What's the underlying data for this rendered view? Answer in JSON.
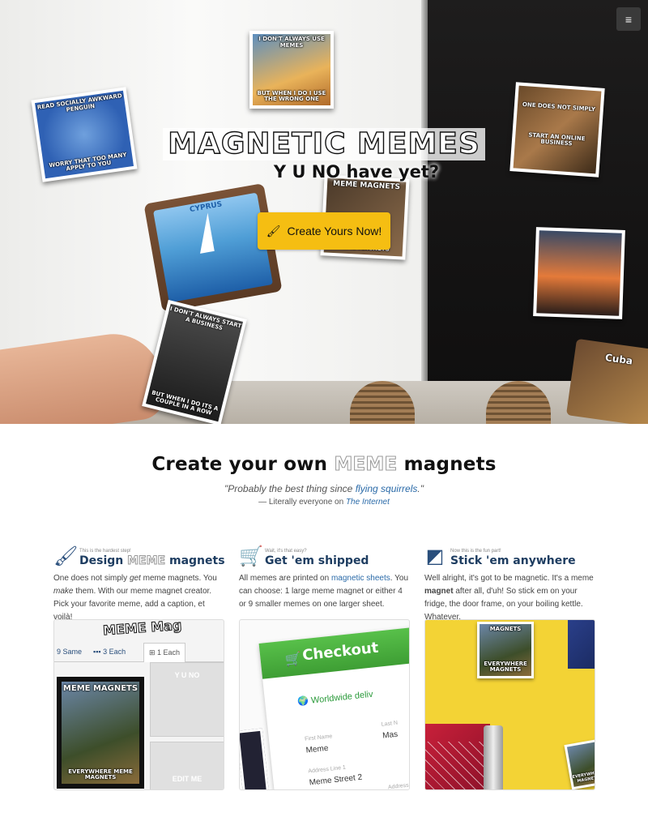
{
  "hero": {
    "logo_text": "MAGNETIC MEMES",
    "tagline": "Y U NO have yet?",
    "cta_label": "Create Yours Now!",
    "cta_icon": "paintbrush-icon",
    "menu_icon": "hamburger-icon",
    "magnets": {
      "penguin_top": "READ SOCIALLY AWKWARD PENGUIN",
      "penguin_bottom": "WORRY THAT TOO MANY APPLY TO YOU",
      "fry_top": "I DON'T ALWAYS USE MEMES",
      "fry_bottom": "BUT WHEN I DO I USE THE WRONG ONE",
      "boromir_top": "ONE DOES NOT SIMPLY",
      "boromir_bottom": "START AN ONLINE BUSINESS",
      "meme_magnets_top": "MEME MAGNETS",
      "meme_magnets_bottom": "MEME MAGNETS",
      "dosequis_top": "I DON'T ALWAYS START A BUSINESS",
      "dosequis_bottom": "BUT WHEN I DO ITS A COUPLE IN A ROW",
      "cyprus_label": "CYPRUS",
      "cuba_label": "Cuba"
    }
  },
  "intro": {
    "heading_pre": "Create your own ",
    "heading_meme": "MEME",
    "heading_post": " magnets",
    "quote_pre": "\"Probably the best thing since ",
    "quote_link": "flying squirrels",
    "quote_post": ".\"",
    "attrib_pre": "— Literally everyone on ",
    "attrib_link": "The Internet"
  },
  "features": [
    {
      "small": "This is the hardest step!",
      "title_pre": "Design ",
      "title_meme": "MEME",
      "title_post": " magnets",
      "icon": "paintbrush-icon",
      "text_a": "One does not simply ",
      "text_em": "get",
      "text_b": " meme magnets. You ",
      "text_em2": "make",
      "text_c": " them. With our meme magnet creator. Pick your favorite meme, add a caption, et voilà!"
    },
    {
      "small": "Wait, it's that easy?",
      "title": "Get 'em shipped",
      "icon": "cart-icon",
      "text_a": "All memes are printed on ",
      "text_link": "magnetic sheets",
      "text_b": ". You can choose: 1 large meme magnet or either 4 or 9 smaller memes on one larger sheet."
    },
    {
      "small": "Now this is the fun part!",
      "title": "Stick 'em anywhere",
      "icon": "sticky-note-icon",
      "text_a": "Well alright, it's got to be magnetic. It's a meme ",
      "text_strong": "magnet",
      "text_b": " after all, d'uh! So stick em on your fridge, the door frame, on your boiling kettle. Whatever."
    }
  ],
  "shot1": {
    "title": "MEME Mag",
    "tab_a": "9 Same",
    "tab_b": "3 Each",
    "tab_c": "1 Each",
    "meme_top": "MEME MAGNETS",
    "meme_bottom": "EVERYWHERE MEME MAGNETS",
    "ghost_a": "Y U NO",
    "ghost_b": "EDIT ME"
  },
  "shot2": {
    "bar_title": "Checkout",
    "worldwide": "Worldwide deliv",
    "first_name_label": "First Name",
    "first_name_value": "Meme",
    "last_name_label": "Last N",
    "last_name_value": "Mas",
    "address_label": "Address Line 1",
    "address_value": "Meme Street 2",
    "extra": "Address"
  },
  "shot3": {
    "top": "MAGNETS",
    "bottom": "EVERYWHERE MAGNETS",
    "side": "EVERYWHERE MAGNETS"
  }
}
